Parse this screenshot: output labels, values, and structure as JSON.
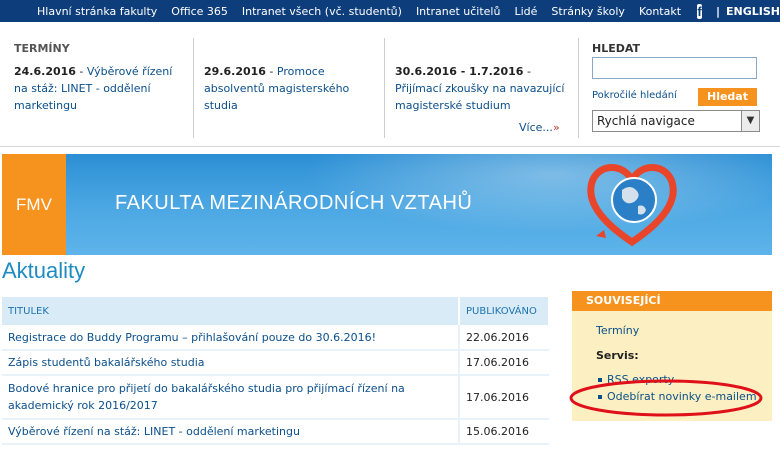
{
  "topnav": {
    "items": [
      "Hlavní stránka fakulty",
      "Office 365",
      "Intranet všech (vč. studentů)",
      "Intranet učitelů",
      "Lidé",
      "Stránky školy",
      "Kontakt"
    ],
    "facebook_icon": "f",
    "separator": "|",
    "english": "ENGLISH"
  },
  "terms": {
    "label": "TERMÍNY",
    "items": [
      {
        "date": "24.6.2016",
        "dash": " - ",
        "text": "Výběrové řízení na stáž: LINET - oddělení marketingu"
      },
      {
        "date": "29.6.2016",
        "dash": " - ",
        "text": "Promoce absolventů magisterského studia"
      },
      {
        "date": "30.6.2016 - 1.7.2016",
        "dash": " - ",
        "text": "Přijímací zkoušky na navazující magisterské studium"
      }
    ],
    "more": "Více...",
    "more_arrow": "»"
  },
  "search": {
    "label": "HLEDAT",
    "value": "",
    "advanced": "Pokročilé hledání",
    "button": "Hledat",
    "quicknav": "Rychlá navigace",
    "quicknav_arrow": "▼"
  },
  "banner": {
    "logo": "FMV",
    "title": "FAKULTA MEZINÁRODNÍCH VZTAHŮ",
    "colors": {
      "logo_bg": "#f6921e",
      "banner_bg": "#2c8fd4"
    }
  },
  "page": {
    "title": "Aktuality"
  },
  "news": {
    "headers": {
      "title": "TITULEK",
      "date": "PUBLIKOVÁNO"
    },
    "rows": [
      {
        "title": "Registrace do Buddy Programu – přihlašování pouze do 30.6.2016!",
        "date": "22.06.2016"
      },
      {
        "title": "Zápis studentů bakalářského studia",
        "date": "17.06.2016"
      },
      {
        "title": "Bodové hranice pro přijetí do bakalářského studia pro přijímací řízení na akademický rok 2016/2017",
        "date": "17.06.2016"
      },
      {
        "title": "Výběrové řízení na stáž: LINET - oddělení marketingu",
        "date": "15.06.2016"
      }
    ]
  },
  "related": {
    "header": "SOUVISEJÍCÍ",
    "link": "Termíny",
    "servis_label": "Servis:",
    "items": [
      "RSS exporty",
      "Odebírat novinky e-mailem"
    ]
  }
}
